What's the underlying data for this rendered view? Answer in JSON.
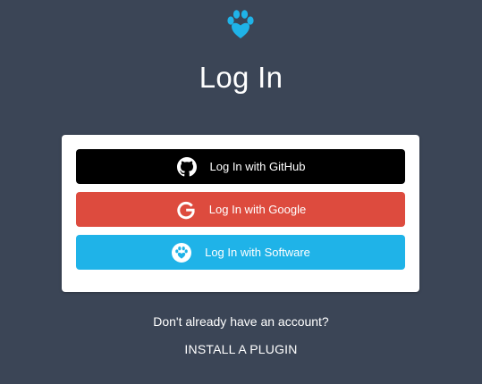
{
  "brand": {
    "logo_icon": "paw-heart-icon",
    "accent_color": "#1fb3e8"
  },
  "page": {
    "title": "Log In",
    "background_color": "#3b4556"
  },
  "login_options": [
    {
      "label": "Log In with GitHub",
      "icon": "github-icon",
      "color": "#000000"
    },
    {
      "label": "Log In with Google",
      "icon": "google-icon",
      "color": "#dd4b3e"
    },
    {
      "label": "Log In with Software",
      "icon": "paw-icon",
      "color": "#1fb3e8"
    }
  ],
  "footer": {
    "prompt": "Don't already have an account?",
    "install_link": "INSTALL A PLUGIN"
  }
}
